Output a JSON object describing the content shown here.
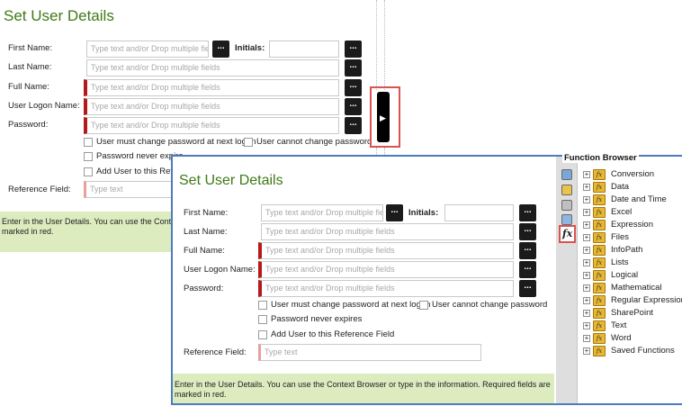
{
  "form": {
    "title": "Set User Details",
    "first_name_label": "First Name:",
    "initials_label": "Initials:",
    "last_name_label": "Last Name:",
    "full_name_label": "Full Name:",
    "logon_label": "User Logon Name:",
    "password_label": "Password:",
    "reference_label": "Reference Field:",
    "field_placeholder": "Type text and/or Drop multiple fields",
    "field_placeholder_short": "Type text and/or Drop multiple fie",
    "ref_placeholder": "Type text",
    "dots_label": "...",
    "cb_must_change": "User must change password at next logon",
    "cb_cannot_change": "User cannot change password",
    "cb_never_expires": "Password never expires",
    "cb_never_expires_cut": "Password never expire",
    "cb_add_user": "Add User to this Reference Field",
    "cb_add_user_cut": "Add User to this Refere",
    "footer": "Enter in the User Details. You can use the Context Browser or type in the information. Required fields are marked in red.",
    "footer_cut": "Enter in the User Details. You can use the Context",
    "footer_cut_2": "marked in red."
  },
  "function_browser": {
    "title": "Function Browser",
    "fx_label": "fx",
    "fx_icon_text": "fx",
    "items": [
      {
        "label": "Conversion"
      },
      {
        "label": "Data"
      },
      {
        "label": "Date and Time"
      },
      {
        "label": "Excel"
      },
      {
        "label": "Expression"
      },
      {
        "label": "Files"
      },
      {
        "label": "InfoPath"
      },
      {
        "label": "Lists"
      },
      {
        "label": "Logical"
      },
      {
        "label": "Mathematical"
      },
      {
        "label": "Regular Expressions"
      },
      {
        "label": "SharePoint"
      },
      {
        "label": "Text"
      },
      {
        "label": "Word"
      },
      {
        "label": "Saved Functions"
      }
    ]
  },
  "colors": {
    "title_green": "#3f7a17",
    "required_red": "#b31b1b",
    "highlight_red": "#d9534f",
    "panel_blue": "#4a7ec1",
    "footer_green": "#dcecbf"
  }
}
